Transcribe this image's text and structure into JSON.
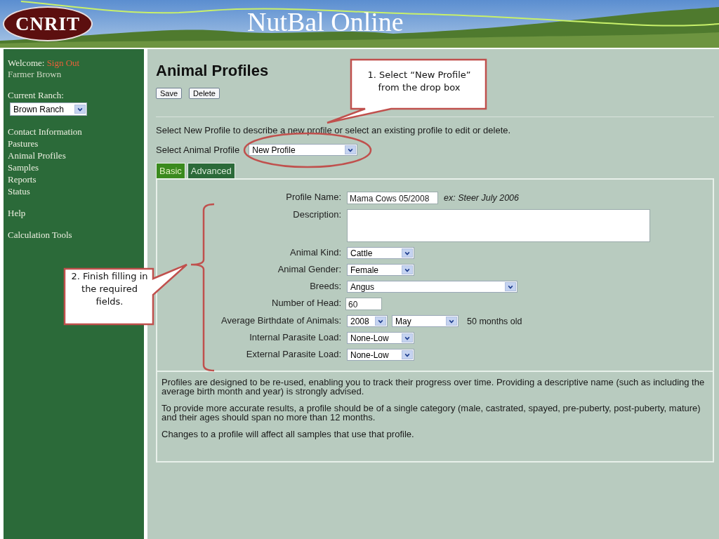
{
  "header": {
    "logo": "CNRIT",
    "title": "NutBal Online"
  },
  "sidebar": {
    "welcome": "Welcome:",
    "sign_out": "Sign Out",
    "user": "Farmer Brown",
    "ranch_label": "Current Ranch:",
    "ranch": "Brown Ranch",
    "nav_groups": [
      [
        "Contact Information",
        "Pastures",
        "Animal Profiles",
        "Samples",
        "Reports",
        "Status"
      ],
      [
        "Help"
      ],
      [
        "Calculation Tools"
      ]
    ]
  },
  "main": {
    "title": "Animal Profiles",
    "buttons": [
      "Save",
      "Delete"
    ],
    "intro": "Select New Profile to describe a new profile or select an existing profile to edit or delete.",
    "profile_select": {
      "label": "Select Animal Profile",
      "value": "New Profile"
    },
    "tabs": [
      {
        "label": "Basic",
        "selected": true
      },
      {
        "label": "Advanced",
        "selected": false
      }
    ],
    "fields": [
      {
        "kind": "text",
        "label": "Profile Name:",
        "value": "Mama Cows 05/2008",
        "hint": "ex: Steer July 2006"
      },
      {
        "kind": "textarea",
        "label": "Description:"
      },
      {
        "kind": "select",
        "label": "Animal Kind:",
        "value": "Cattle"
      },
      {
        "kind": "select",
        "label": "Animal Gender:",
        "value": "Female"
      },
      {
        "kind": "wide-select",
        "label": "Breeds:",
        "value": "Angus"
      },
      {
        "kind": "number",
        "label": "Number of Head:",
        "value": "60"
      },
      {
        "kind": "date",
        "label": "Average Birthdate of Animals:",
        "year": "2008",
        "month": "May",
        "note": "50 months old"
      },
      {
        "kind": "select",
        "label": "Internal Parasite Load:",
        "value": "None-Low"
      },
      {
        "kind": "select",
        "label": "External Parasite Load:",
        "value": "None-Low"
      }
    ],
    "notes": [
      "Profiles are designed to be re-used, enabling you to track their progress over time. Providing a descriptive name (such as including the average birth month and year) is strongly advised.",
      "To provide more accurate results, a profile should be of a single category (male, castrated, spayed, pre-puberty, post-puberty, mature) and their ages should span no more than 12 months.",
      "Changes to a profile will affect all samples that use that profile."
    ]
  },
  "annotations": [
    {
      "kind": "top",
      "text": "1.  Select “New Profile” from the drop box"
    },
    {
      "kind": "left",
      "text": "2.  Finish filling in the required fields."
    }
  ]
}
